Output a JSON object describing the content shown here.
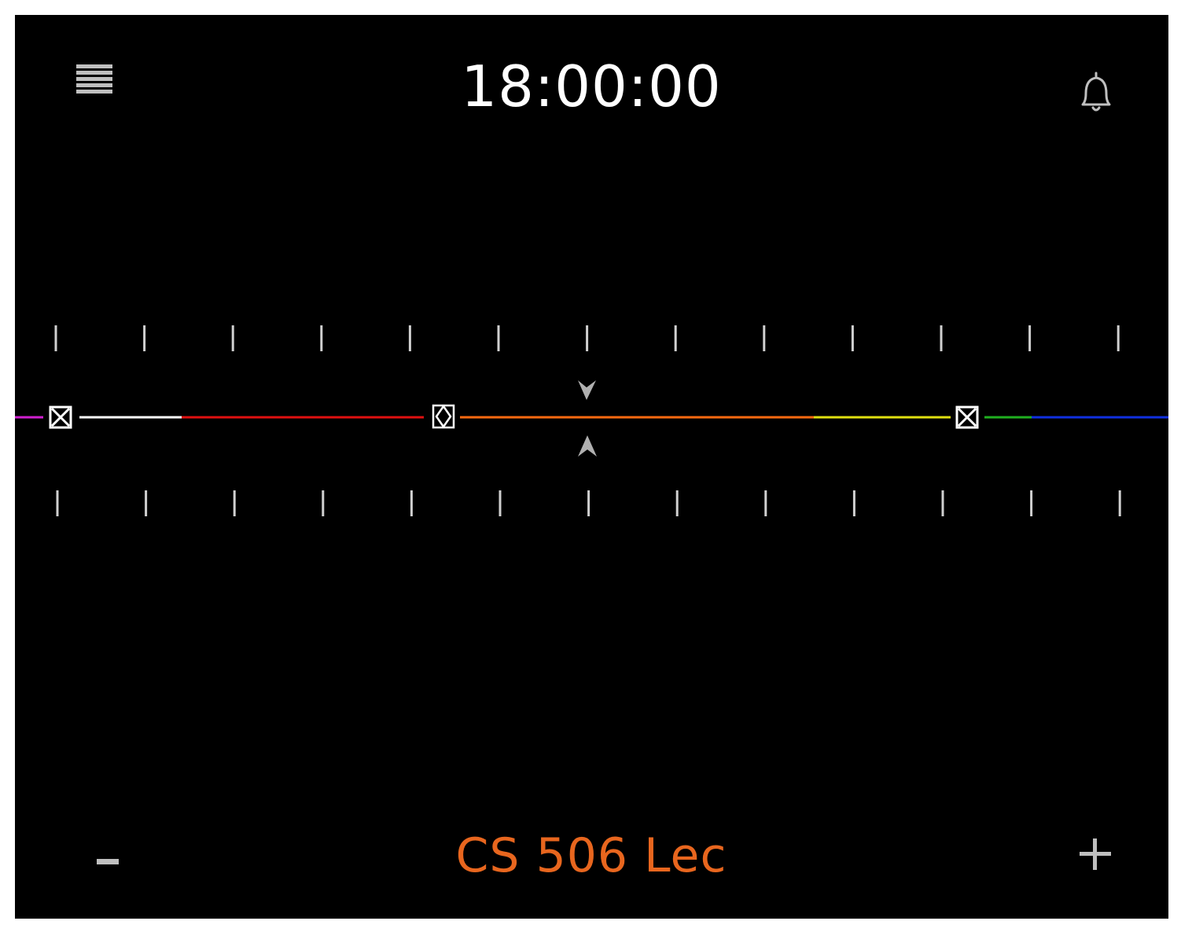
{
  "header": {
    "time": "18:00:00",
    "menu_icon": "hamburger-menu-icon",
    "alarm_icon": "bell-icon"
  },
  "timeline": {
    "segment_colors": [
      "#d020d0",
      "#ffffff",
      "#e01010",
      "#ff6a10",
      "#e0e010",
      "#20b020",
      "#1030e0"
    ],
    "markers": [
      {
        "icon": "boxed-x-icon",
        "type": "event-boundary"
      },
      {
        "icon": "boxed-diamond-icon",
        "type": "event-boundary"
      },
      {
        "icon": "boxed-x-icon",
        "type": "event-boundary"
      }
    ],
    "current_time_indicator": "arrow-pair-icon"
  },
  "footer": {
    "event_title": "CS 506 Lec",
    "event_title_color": "#e8661e",
    "minus_label": "−",
    "plus_label": "+"
  }
}
